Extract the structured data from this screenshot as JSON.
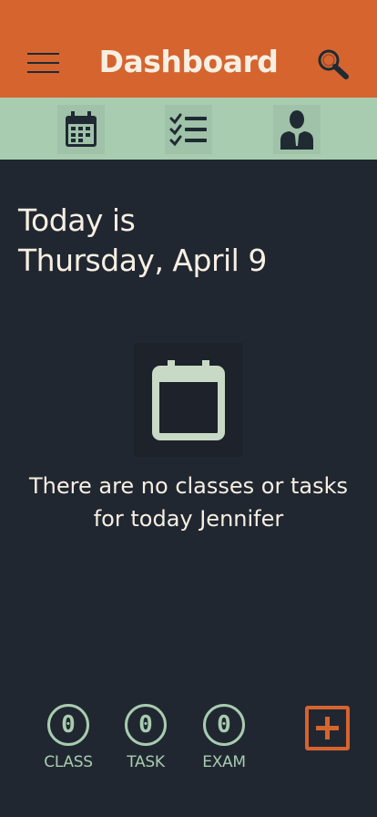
{
  "header": {
    "title": "Dashboard",
    "menu_icon": "hamburger-menu-icon",
    "search_icon": "search-icon",
    "background": "#d6642f"
  },
  "icon_bar": {
    "items": [
      {
        "icon": "calendar-icon"
      },
      {
        "icon": "checklist-icon"
      },
      {
        "icon": "profile-icon"
      }
    ],
    "background": "#a8ccb0"
  },
  "date": {
    "line1": "Today is",
    "line2": "Thursday, April 9"
  },
  "empty_state": {
    "icon": "calendar-empty-icon",
    "message": "There are no classes or tasks for today Jennifer"
  },
  "counters": [
    {
      "value": "0",
      "label": "CLASS"
    },
    {
      "value": "0",
      "label": "TASK"
    },
    {
      "value": "0",
      "label": "EXAM"
    }
  ],
  "add_button": {
    "icon": "add-icon"
  },
  "colors": {
    "background": "#212731",
    "accent": "#d6642f",
    "mint": "#a8ccb0",
    "text": "#f6efe2"
  }
}
